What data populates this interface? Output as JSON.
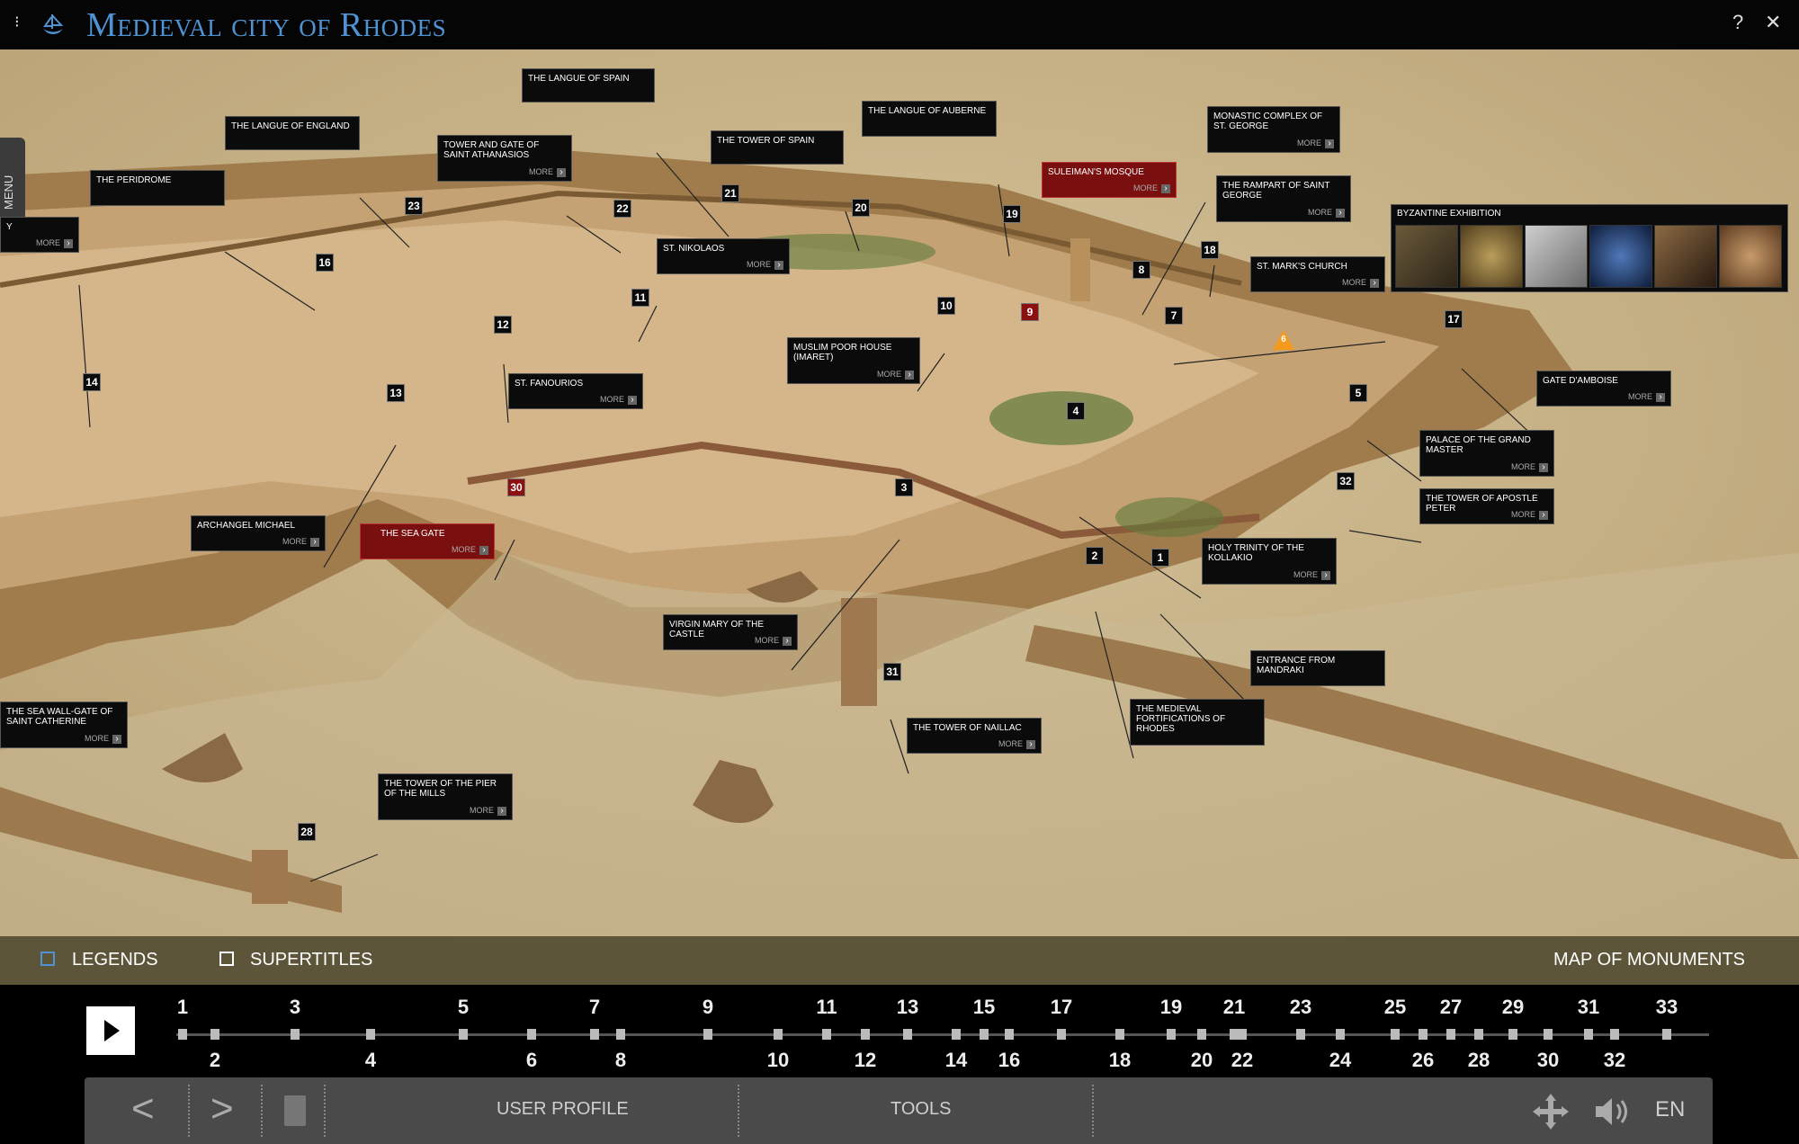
{
  "app": {
    "title": "Medieval city of Rhodes",
    "menu_glyph": "⁝",
    "help": "?",
    "close": "✕"
  },
  "menu": {
    "label": "MENU"
  },
  "map": {
    "more_label": "MORE",
    "labels": [
      {
        "text": "THE LANGUE OF SPAIN",
        "more": false
      },
      {
        "text": "THE LANGUE OF ENGLAND",
        "more": false
      },
      {
        "text": "TOWER AND GATE OF SAINT ATHANASIOS",
        "more": true
      },
      {
        "text": "THE TOWER OF SPAIN",
        "more": false
      },
      {
        "text": "THE LANGUE OF AUBERNE",
        "more": false
      },
      {
        "text": "MONASTIC COMPLEX OF ST. GEORGE",
        "more": true
      },
      {
        "text": "SULEIMAN'S MOSQUE",
        "more": true
      },
      {
        "text": "THE RAMPART OF SAINT GEORGE",
        "more": true
      },
      {
        "text": "THE PERIDROME",
        "more": false
      },
      {
        "text": "Y",
        "more": true
      },
      {
        "text": "ST. NIKOLAOS",
        "more": true
      },
      {
        "text": "ST. MARK'S CHURCH",
        "more": true
      },
      {
        "text": "MUSLIM POOR HOUSE (IMARET)",
        "more": true
      },
      {
        "text": "ST. FANOURIOS",
        "more": true
      },
      {
        "text": "GATE D'AMBOISE",
        "more": true
      },
      {
        "text": "PALACE OF THE GRAND MASTER",
        "more": true
      },
      {
        "text": "THE TOWER OF APOSTLE PETER",
        "more": true
      },
      {
        "text": "ARCHANGEL MICHAEL",
        "more": true
      },
      {
        "text": "THE SEA GATE",
        "more": true
      },
      {
        "text": "HOLY TRINITY OF THE KOLLAKIO",
        "more": true
      },
      {
        "text": "VIRGIN MARY OF THE CASTLE",
        "more": true
      },
      {
        "text": "ENTRANCE FROM MANDRAKI",
        "more": false
      },
      {
        "text": "THE SEA WALL-GATE OF SAINT CATHERINE",
        "more": true
      },
      {
        "text": "THE MEDIEVAL FORTIFICATIONS OF RHODES",
        "more": false
      },
      {
        "text": "THE TOWER OF NAILLAC",
        "more": true
      },
      {
        "text": "THE TOWER OF THE PIER OF THE MILLS",
        "more": true
      }
    ],
    "markers": [
      "23",
      "22",
      "21",
      "20",
      "19",
      "18",
      "16",
      "11",
      "10",
      "9",
      "8",
      "7",
      "12",
      "14",
      "13",
      "17",
      "6",
      "5",
      "4",
      "32",
      "3",
      "30",
      "2",
      "1",
      "31",
      "28"
    ],
    "byzantine_exhibition": {
      "title": "BYZANTINE EXHIBITION"
    }
  },
  "legend_bar": {
    "legends_label": "LEGENDS",
    "supertitles_label": "SUPERTITLES",
    "map_of_monuments": "MAP OF MONUMENTS"
  },
  "timeline": {
    "top_numbers": [
      "1",
      "3",
      "5",
      "7",
      "9",
      "11",
      "13",
      "15",
      "17",
      "19",
      "21",
      "23",
      "25",
      "27",
      "29",
      "31",
      "33"
    ],
    "bottom_numbers": [
      "2",
      "4",
      "6",
      "8",
      "10",
      "12",
      "14",
      "16",
      "18",
      "20",
      "22",
      "24",
      "26",
      "28",
      "30",
      "32"
    ]
  },
  "toolbar": {
    "prev": "<",
    "next": ">",
    "user_profile": "USER PROFILE",
    "tools": "TOOLS",
    "language": "EN"
  }
}
